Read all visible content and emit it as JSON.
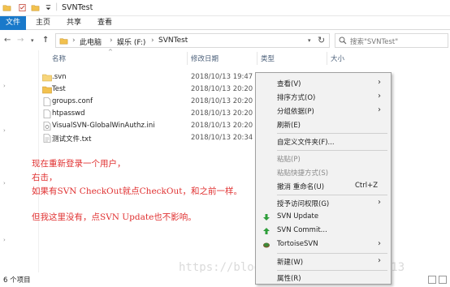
{
  "window": {
    "title": "SVNTest"
  },
  "ribbon": {
    "tabs": [
      "文件",
      "主页",
      "共享",
      "查看"
    ]
  },
  "address": {
    "segments": [
      "此电脑",
      "娱乐 (F:)",
      "SVNTest"
    ],
    "search_placeholder": "搜索\"SVNTest\""
  },
  "columns": [
    "名称",
    "修改日期",
    "类型",
    "大小"
  ],
  "files": [
    {
      "name": ".svn",
      "date": "2018/10/13 19:47",
      "kind": "folder"
    },
    {
      "name": "Test",
      "date": "2018/10/13 20:20",
      "kind": "folder"
    },
    {
      "name": "groups.conf",
      "date": "2018/10/13 20:20",
      "kind": "file"
    },
    {
      "name": "htpasswd",
      "date": "2018/10/13 20:20",
      "kind": "file"
    },
    {
      "name": "VisualSVN-GlobalWinAuthz.ini",
      "date": "2018/10/13 20:20",
      "kind": "file"
    },
    {
      "name": "测试文件.txt",
      "date": "2018/10/13 20:34",
      "kind": "file"
    }
  ],
  "notes": [
    "现在重新登录一个用户，",
    "右击，",
    "如果有SVN CheckOut就点CheckOut，和之前一样。",
    "但我这里没有，点SVN Update也不影响。"
  ],
  "status": {
    "item_count": "6 个项目"
  },
  "context_menu": {
    "items": [
      {
        "label": "查看(V)",
        "submenu": true
      },
      {
        "label": "排序方式(O)",
        "submenu": true
      },
      {
        "label": "分组依据(P)",
        "submenu": true
      },
      {
        "label": "刷新(E)"
      },
      {
        "label": "自定义文件夹(F)..."
      },
      {
        "label": "粘贴(P)",
        "disabled": true
      },
      {
        "label": "粘贴快捷方式(S)",
        "disabled": true
      },
      {
        "label": "撤消 重命名(U)",
        "shortcut": "Ctrl+Z"
      },
      {
        "label": "授予访问权限(G)",
        "submenu": true
      },
      {
        "label": "SVN Update",
        "icon": "svn-update-icon"
      },
      {
        "label": "SVN Commit...",
        "icon": "svn-commit-icon"
      },
      {
        "label": "TortoiseSVN",
        "icon": "tortoisesvn-icon",
        "submenu": true
      },
      {
        "label": "新建(W)",
        "submenu": true
      },
      {
        "label": "属性(R)"
      }
    ]
  },
  "watermark": "https://blog.csdn.net/qq_42347913",
  "colors": {
    "accent": "#1979ca",
    "note": "#e03131",
    "folder": "#f2c14e"
  }
}
